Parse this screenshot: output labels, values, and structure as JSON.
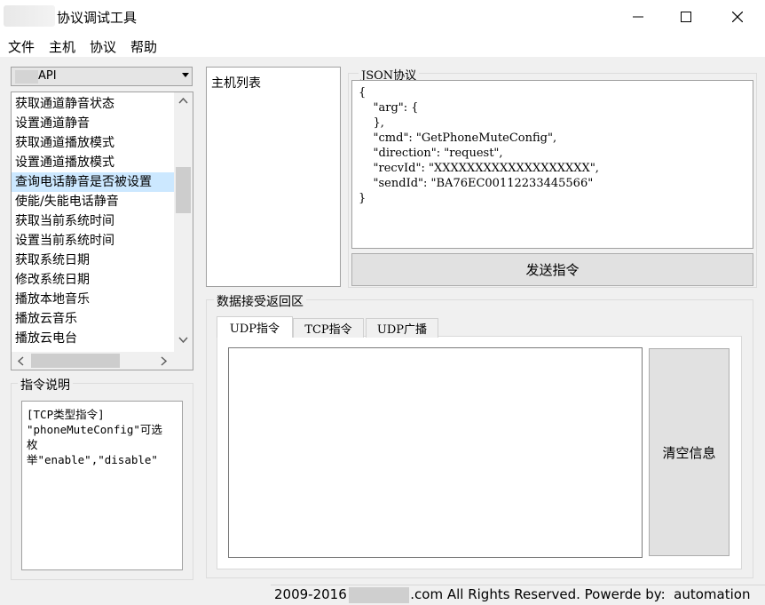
{
  "window": {
    "title": "协议调试工具",
    "minimize_glyph": "—",
    "maximize_glyph": "☐",
    "close_glyph": "✕"
  },
  "menu": [
    "文件",
    "主机",
    "协议",
    "帮助"
  ],
  "api_combo": {
    "selected": "API"
  },
  "command_list": {
    "items": [
      "获取通道静音状态",
      "设置通道静音",
      "获取通道播放模式",
      "设置通道播放模式",
      "查询电话静音是否被设置",
      "使能/失能电话静音",
      "获取当前系统时间",
      "设置当前系统时间",
      "获取系统日期",
      "修改系统日期",
      "播放本地音乐",
      "播放云音乐",
      "播放云电台"
    ],
    "selected_index": 4
  },
  "description": {
    "label": "指令说明",
    "text": "[TCP类型指令]\n\"phoneMuteConfig\"可选\n枚\n举\"enable\",\"disable\""
  },
  "host_list": {
    "label": "主机列表"
  },
  "json_protocol": {
    "label": "JSON协议",
    "content": "{\n    \"arg\": {\n    },\n    \"cmd\": \"GetPhoneMuteConfig\",\n    \"direction\": \"request\",\n    \"recvId\": \"XXXXXXXXXXXXXXXXXXX\",\n    \"sendId\": \"BA76EC00112233445566\"\n}"
  },
  "send_button": "发送指令",
  "receive": {
    "label": "数据接受返回区",
    "tabs": [
      "UDP指令",
      "TCP指令",
      "UDP广播"
    ],
    "active_tab": 0,
    "clear_button": "清空信息"
  },
  "status": {
    "text": "2009-2016               .com All Rights Reserved. Powerde by:  automation"
  },
  "icons": {
    "scroll_up": "up-arrow-icon",
    "scroll_down": "down-arrow-icon",
    "scroll_left": "left-arrow-icon",
    "scroll_right": "right-arrow-icon",
    "combo_dropdown": "chevron-down-icon"
  }
}
